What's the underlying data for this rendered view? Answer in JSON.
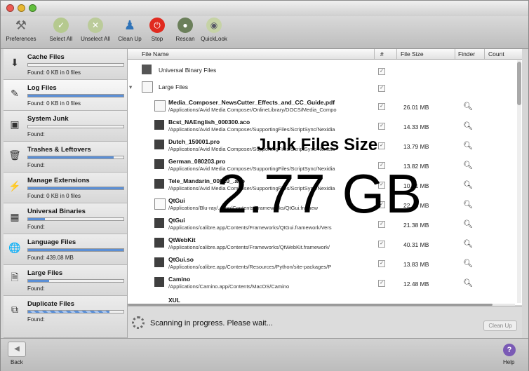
{
  "toolbar": {
    "preferences": "Preferences",
    "select_all": "Select All",
    "unselect_all": "Unselect All",
    "clean_up": "Clean Up",
    "stop": "Stop",
    "rescan": "Rescan",
    "quicklook": "QuickLook"
  },
  "sidebar": {
    "items": [
      {
        "title": "Cache Files",
        "found": "Found: 0  KB in 0 files",
        "progress": 0.0
      },
      {
        "title": "Log Files",
        "found": "Found: 0  KB in 0 files",
        "progress": 1.0
      },
      {
        "title": "System Junk",
        "found": "Found:",
        "progress": 0.0
      },
      {
        "title": "Trashes & Leftovers",
        "found": "Found:",
        "progress": 0.9
      },
      {
        "title": "Manage Extensions",
        "found": "Found: 0  KB in 0 files",
        "progress": 1.0
      },
      {
        "title": "Universal Binaries",
        "found": "Found:",
        "progress": 0.18
      },
      {
        "title": "Language Files",
        "found": "Found: 439.08 MB",
        "progress": 1.0
      },
      {
        "title": "Large Files",
        "found": "Found:",
        "progress": 0.22
      },
      {
        "title": "Duplicate Files",
        "found": "Found:",
        "progress": 0.85
      }
    ]
  },
  "table": {
    "columns": {
      "name": "File Name",
      "check": "#",
      "size": "File Size",
      "finder": "Finder",
      "count": "Count"
    },
    "groups": {
      "universal": "Universal Binary Files",
      "large": "Large Files"
    },
    "rows": [
      {
        "name": "Media_Composer_NewsCutter_Effects_and_CC_Guide.pdf",
        "path": "/Applications/Avid Media Composer/OnlineLibrary/DOCS/Media_Compo",
        "size": "26.01 MB"
      },
      {
        "name": "Bcst_NAEnglish_000300.aco",
        "path": "/Applications/Avid Media Composer/SupportingFiles/ScriptSync/Nexidia",
        "size": "14.33 MB"
      },
      {
        "name": "Dutch_150001.pro",
        "path": "/Applications/Avid Media Composer/SupportingFiles/ScriptSync/Nexidia",
        "size": "13.79 MB"
      },
      {
        "name": "German_080203.pro",
        "path": "/Applications/Avid Media Composer/SupportingFiles/ScriptSync/Nexidia",
        "size": "13.82 MB"
      },
      {
        "name": "Tele_Mandarin_00020_.aco",
        "path": "/Applications/Avid Media Composer/SupportingFiles/ScriptSync/Nexidia",
        "size": "10.81 MB"
      },
      {
        "name": "QtGui",
        "path": "/Applications/Blu-ray/...app/Contents/Frameworks/QtGui.framew",
        "size": "22.40 MB"
      },
      {
        "name": "QtGui",
        "path": "/Applications/calibre.app/Contents/Frameworks/QtGui.framework/Vers",
        "size": "21.38 MB"
      },
      {
        "name": "QtWebKit",
        "path": "/Applications/calibre.app/Contents/Frameworks/QtWebKit.framework/",
        "size": "40.31 MB"
      },
      {
        "name": "QtGui.so",
        "path": "/Applications/calibre.app/Contents/Resources/Python/site-packages/P",
        "size": "13.83 MB"
      },
      {
        "name": "Camino",
        "path": "/Applications/Camino.app/Contents/MacOS/Camino",
        "size": "12.48 MB"
      }
    ],
    "partial_row": "XUL"
  },
  "overlay": {
    "label": "Junk Files Size",
    "value": "2.77 GB"
  },
  "status": {
    "text": "Scanning in progress. Please wait...",
    "cleanup_button": "Clean Up"
  },
  "bottom": {
    "back": "Back",
    "help": "Help"
  }
}
